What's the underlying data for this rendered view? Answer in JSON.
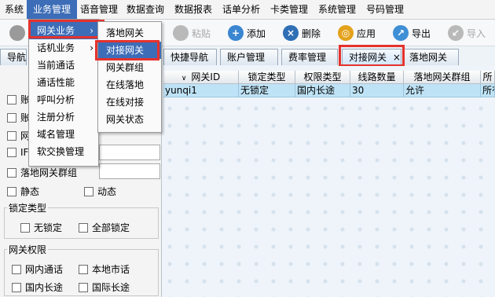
{
  "menubar": {
    "items": [
      "系统",
      "业务管理",
      "语音管理",
      "数据查询",
      "数据报表",
      "话单分析",
      "卡类管理",
      "系统管理",
      "号码管理"
    ]
  },
  "toolbar": {
    "paste": "粘贴",
    "add": "添加",
    "delete": "删除",
    "apply": "应用",
    "export": "导出",
    "import": "导入"
  },
  "tabs": [
    "导航",
    "快捷导航",
    "账户管理",
    "费率管理",
    "对接网关",
    "落地网关"
  ],
  "tab_close": "×",
  "menu_business": {
    "items": [
      "网关业务",
      "话机业务",
      "当前通话",
      "通话性能",
      "呼叫分析",
      "注册分析",
      "域名管理",
      "软交换管理"
    ]
  },
  "menu_gateway": {
    "items": [
      "落地网关",
      "对接网关",
      "网关群组",
      "在线落地",
      "在线对接",
      "网关状态"
    ]
  },
  "left_panel": {
    "partial_rows": [
      "账",
      "账",
      "网",
      "IF"
    ],
    "landing_group_label": "落地网关群组",
    "static": "静态",
    "dynamic": "动态",
    "lock_type_title": "锁定类型",
    "unlocked": "无锁定",
    "all_locked": "全部锁定",
    "gateway_perm_title": "网关权限",
    "intra_call": "网内通话",
    "local_call": "本地市话",
    "domestic_ld": "国内长途",
    "intl_ld": "国际长途"
  },
  "grid": {
    "columns": [
      "网关ID",
      "锁定类型",
      "权限类型",
      "线路数量",
      "落地网关群组",
      "所"
    ],
    "rows": [
      [
        "yunqi1",
        "无锁定",
        "国内长途",
        "30",
        "允许",
        "所有"
      ]
    ]
  },
  "colors": {
    "menu_highlight": "#3d6db7",
    "annotation_red": "#e5322d",
    "row_selected": "#bfe3f6"
  }
}
